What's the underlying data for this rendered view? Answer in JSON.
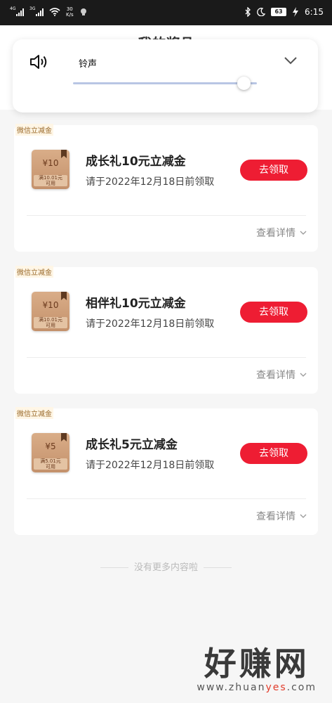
{
  "status_bar": {
    "signal1_tag": "4G",
    "signal2_tag": "3G",
    "speed_value": "30",
    "speed_unit": "K/s",
    "battery": "63",
    "time": "6:15"
  },
  "page": {
    "title": "我的奖品"
  },
  "volume_panel": {
    "label": "铃声",
    "level": 0.93
  },
  "cards": [
    {
      "tag": "微信立减金",
      "coupon_amount": "¥10",
      "coupon_condition_1": "满10.01元",
      "coupon_condition_2": "可用",
      "title": "成长礼10元立减金",
      "subtitle": "请于2022年12月18日前领取",
      "button": "去领取",
      "detail": "查看详情"
    },
    {
      "tag": "微信立减金",
      "coupon_amount": "¥10",
      "coupon_condition_1": "满10.01元",
      "coupon_condition_2": "可用",
      "title": "相伴礼10元立减金",
      "subtitle": "请于2022年12月18日前领取",
      "button": "去领取",
      "detail": "查看详情"
    },
    {
      "tag": "微信立减金",
      "coupon_amount": "¥5",
      "coupon_condition_1": "满5.01元",
      "coupon_condition_2": "可用",
      "title": "成长礼5元立减金",
      "subtitle": "请于2022年12月18日前领取",
      "button": "去领取",
      "detail": "查看详情"
    }
  ],
  "footer": {
    "no_more": "没有更多内容啦"
  },
  "watermark": {
    "big": "好赚网",
    "small_pre": "www.zhuan",
    "small_yes": "yes",
    "small_post": ".com"
  },
  "colors": {
    "accent": "#ee1d33",
    "coupon": "#c4916b",
    "tag_text": "#9a6a2b"
  }
}
